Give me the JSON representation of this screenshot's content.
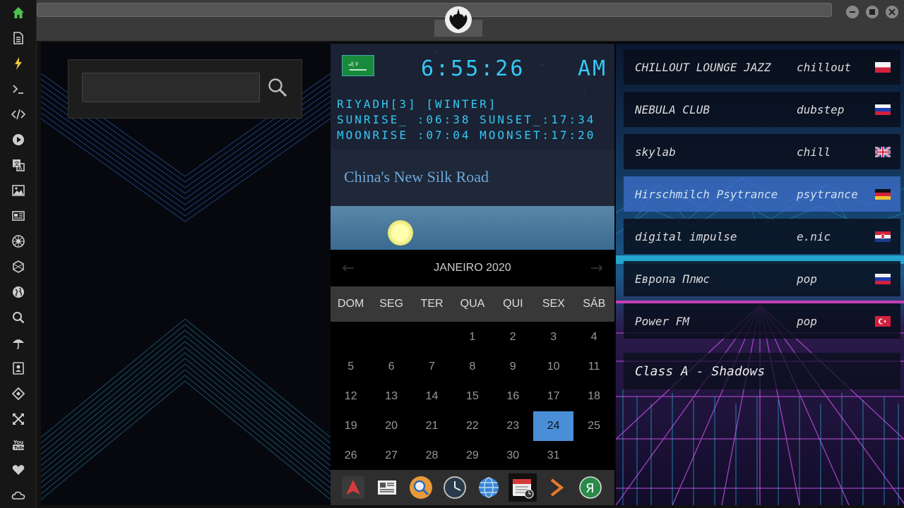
{
  "window": {
    "address_bar": ""
  },
  "sidebar": {
    "items": [
      {
        "icon": "home-icon",
        "color": "#4ec44e"
      },
      {
        "icon": "document-icon"
      },
      {
        "icon": "lightning-icon",
        "color": "#e8c53a"
      },
      {
        "icon": "terminal-icon"
      },
      {
        "icon": "code-icon"
      },
      {
        "icon": "play-icon"
      },
      {
        "icon": "translate-icon"
      },
      {
        "icon": "image-icon"
      },
      {
        "icon": "news-icon"
      },
      {
        "icon": "empire-icon"
      },
      {
        "icon": "hexagon-icon"
      },
      {
        "icon": "globe-icon"
      },
      {
        "icon": "search-icon"
      },
      {
        "icon": "umbrella-icon"
      },
      {
        "icon": "contacts-icon"
      },
      {
        "icon": "diamond-icon"
      },
      {
        "icon": "expand-icon"
      },
      {
        "icon": "youtube-icon"
      },
      {
        "icon": "heart-icon"
      },
      {
        "icon": "cloud-icon"
      }
    ]
  },
  "search": {
    "placeholder": "",
    "value": ""
  },
  "clock": {
    "time": "6:55:26",
    "ampm": "AM",
    "line1": "RIYADH[3] [WINTER]",
    "line2": "SUNRISE_ :06:38 SUNSET_:17:34",
    "line3": "MOONRISE :07:04 MOONSET:17:20",
    "flag": "saudi-arabia-flag"
  },
  "news": {
    "title": "China's New Silk Road"
  },
  "calendar": {
    "month_label": "JANEIRO 2020",
    "days_of_week": [
      "DOM",
      "SEG",
      "TER",
      "QUA",
      "QUI",
      "SEX",
      "SÁB"
    ],
    "weeks": [
      [
        "",
        "",
        "",
        "1",
        "2",
        "3",
        "4"
      ],
      [
        "5",
        "6",
        "7",
        "8",
        "9",
        "10",
        "11"
      ],
      [
        "12",
        "13",
        "14",
        "15",
        "16",
        "17",
        "18"
      ],
      [
        "19",
        "20",
        "21",
        "22",
        "23",
        "24",
        "25"
      ],
      [
        "26",
        "27",
        "28",
        "29",
        "30",
        "31",
        ""
      ]
    ],
    "selected_day": "24",
    "selected_color": "#4a8ed8"
  },
  "dock": {
    "apps": [
      "app-launcher-icon",
      "newspaper-icon",
      "search-app-icon",
      "clock-app-icon",
      "browser-icon",
      "calendar-app-icon",
      "next-arrow-icon",
      "yandex-icon"
    ]
  },
  "radio": {
    "stations": [
      {
        "name": "CHILLOUT LOUNGE JAZZ",
        "genre": "chillout",
        "flag": "poland-flag"
      },
      {
        "name": "NEBULA CLUB",
        "genre": "dubstep",
        "flag": "russia-flag"
      },
      {
        "name": "skylab",
        "genre": "chill",
        "flag": "uk-flag"
      },
      {
        "name": "Hirschmilch Psytrance",
        "genre": "psytrance",
        "flag": "germany-flag",
        "active": true
      },
      {
        "name": "digital impulse",
        "genre": "e.nic",
        "flag": "croatia-flag"
      },
      {
        "name": "Европа Плюс",
        "genre": "pop",
        "flag": "russia-flag"
      },
      {
        "name": "Power FM",
        "genre": "pop",
        "flag": "turkey-flag"
      }
    ],
    "now_playing": "Class A - Shadows"
  }
}
